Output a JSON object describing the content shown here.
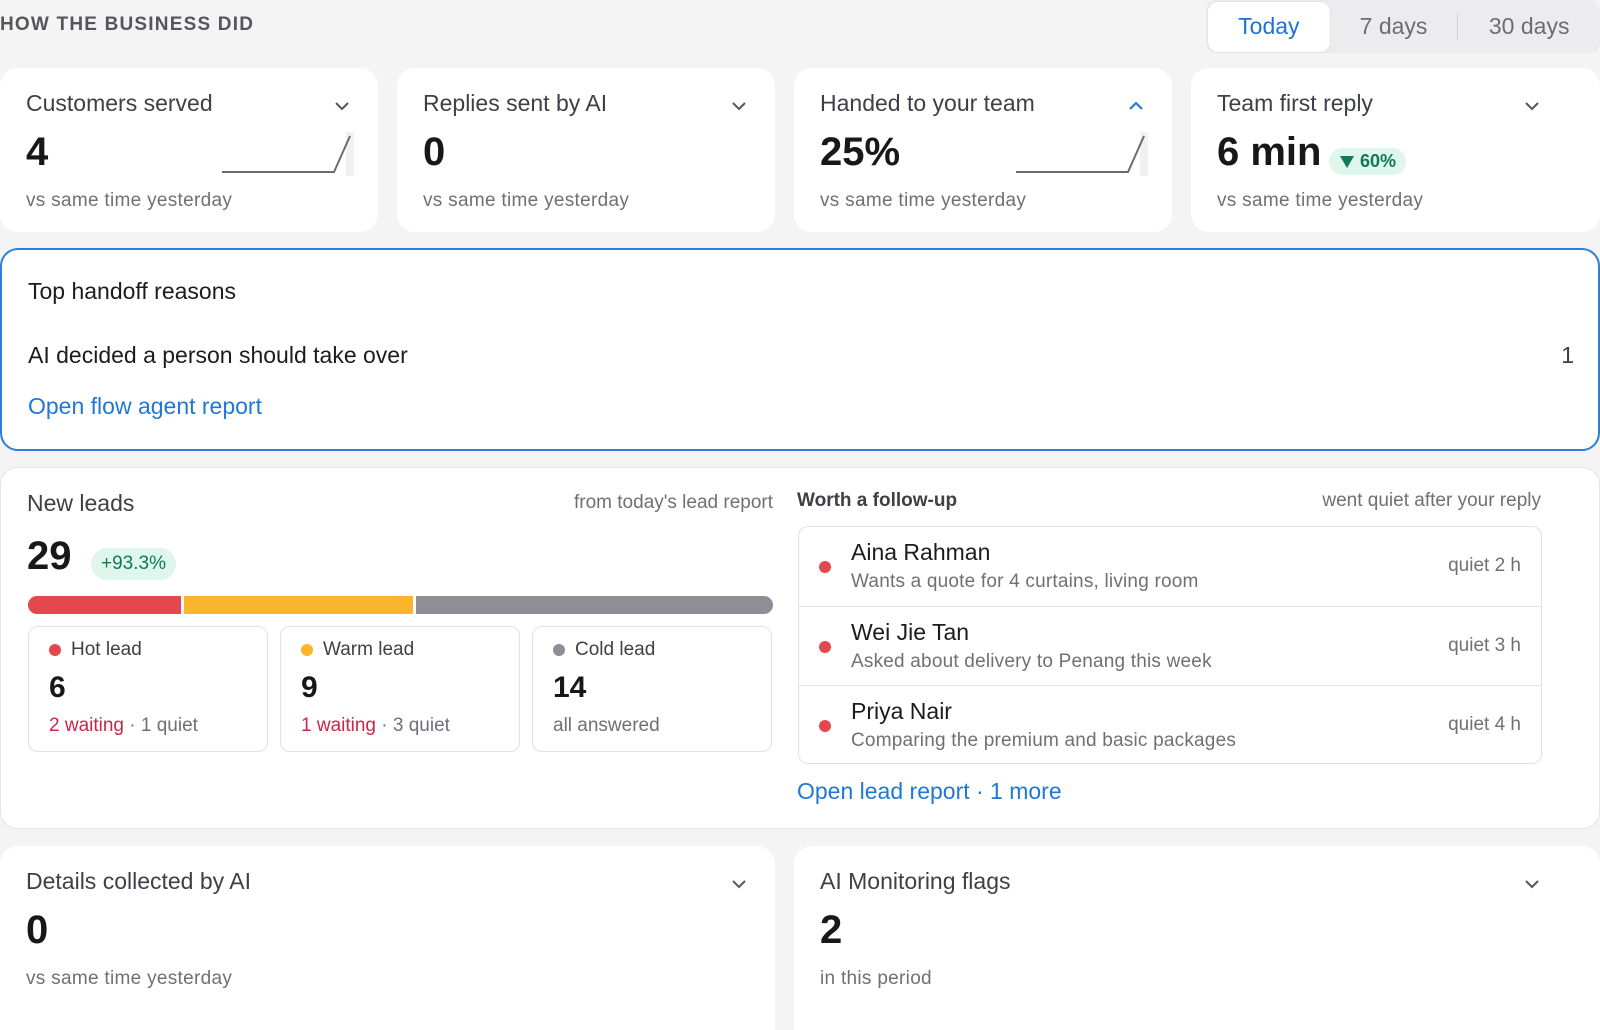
{
  "header": {
    "title": "HOW THE BUSINESS DID",
    "ranges": [
      "Today",
      "7 days",
      "30 days"
    ],
    "active_range": "Today"
  },
  "metrics": [
    {
      "title": "Customers served",
      "value": "4",
      "sub": "vs same time yesterday",
      "chevron": "chevron-down-icon",
      "trend": "rising-sparkline"
    },
    {
      "title": "Replies sent by AI",
      "value": "0",
      "sub": "vs same time yesterday",
      "chevron": "chevron-down-icon"
    },
    {
      "title": "Handed to your team",
      "value": "25%",
      "sub": "vs same time yesterday",
      "chevron": "chevron-up-icon",
      "trend": "rising-sparkline"
    },
    {
      "title": "Team first reply",
      "value": "6 min",
      "sub": "vs same time yesterday",
      "chevron": "chevron-down-icon",
      "badge": "60%",
      "badge_icon": "triangle-down-icon"
    }
  ],
  "handoff": {
    "title": "Top handoff reasons",
    "reasons": [
      {
        "label": "AI decided a person should take over",
        "count": "1"
      }
    ],
    "link": "Open flow agent report"
  },
  "leads": {
    "title": "New leads",
    "source": "from today's lead report",
    "value": "29",
    "change": "+93.3%",
    "distribution": [
      {
        "name": "Hot lead",
        "count": 6,
        "color": "#e5474f"
      },
      {
        "name": "Warm lead",
        "count": 9,
        "color": "#fab52c"
      },
      {
        "name": "Cold lead",
        "count": 14,
        "color": "#8e8e96"
      }
    ],
    "tiles": [
      {
        "label": "Hot lead",
        "value": "6",
        "waiting": "2 waiting",
        "rest": " · 1 quiet",
        "color": "#e5474f"
      },
      {
        "label": "Warm lead",
        "value": "9",
        "waiting": "1 waiting",
        "rest": " · 3 quiet",
        "color": "#fab52c"
      },
      {
        "label": "Cold lead",
        "value": "14",
        "waiting": "",
        "rest": "all answered",
        "color": "#8e8e96"
      }
    ]
  },
  "followup": {
    "title": "Worth a follow-up",
    "note": "went quiet after your reply",
    "items": [
      {
        "name": "Aina Rahman",
        "desc": "Wants a quote for 4 curtains, living room",
        "time": "quiet 2 h"
      },
      {
        "name": "Wei Jie Tan",
        "desc": "Asked about delivery to Penang this week",
        "time": "quiet 3 h"
      },
      {
        "name": "Priya Nair",
        "desc": "Comparing the premium and basic packages",
        "time": "quiet 4 h"
      }
    ],
    "link": "Open lead report · 1 more"
  },
  "bottom": [
    {
      "title": "Details collected by AI",
      "value": "0",
      "sub": "vs same time yesterday",
      "chevron": "chevron-down-icon"
    },
    {
      "title": "AI Monitoring flags",
      "value": "2",
      "sub": "in this period",
      "chevron": "chevron-down-icon"
    }
  ],
  "colors": {
    "accent": "#1f77d6",
    "positive_bg": "#def6ec",
    "positive_text": "#11795a",
    "waiting": "#c8264a"
  }
}
